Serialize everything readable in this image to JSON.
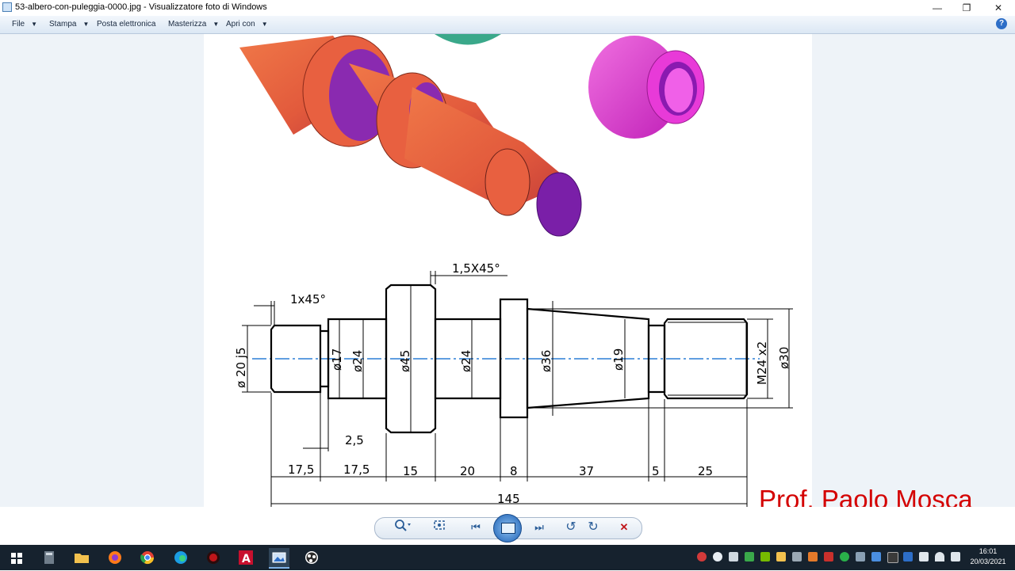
{
  "window": {
    "title": "53-albero-con-puleggia-0000.jpg - Visualizzatore foto di Windows",
    "minimize_glyph": "—",
    "maximize_glyph": "❐",
    "close_glyph": "✕"
  },
  "menu": {
    "items": [
      "File",
      "Stampa",
      "Posta elettronica",
      "Masterizza",
      "Apri con"
    ],
    "help_glyph": "?"
  },
  "drawing": {
    "dims": {
      "chamfer_1": "1x45°",
      "chamfer_2": "1,5X45°",
      "d20": "ø 20  j5",
      "d17": "ø17",
      "d24a": "ø24",
      "d45": "ø45",
      "d24b": "ø24",
      "d36": "ø36",
      "d19": "ø19",
      "m24": "M24 x2",
      "d30": "ø30",
      "groove": "2,5",
      "len_1": "17,5",
      "len_2": "17,5",
      "len_3": "15",
      "len_4": "20",
      "len_5": "8",
      "len_6": "37",
      "len_7": "5",
      "len_8": "25",
      "total": "145"
    }
  },
  "watermark": "Prof. Paolo Mosca",
  "controls": {
    "zoom": "magnifier-icon",
    "fit": "fit-icon",
    "prev": "⏮",
    "next": "⏭",
    "rotate_ccw": "↺",
    "rotate_cw": "↻",
    "delete": "✕"
  },
  "taskbar": {
    "time": "16:01",
    "date": "20/03/2021"
  },
  "colors": {
    "shaft": "#e85a3a",
    "shaft_dark": "#7a1fa8",
    "bushing": "#e23ad0",
    "pulley": "#3aa88a",
    "centerline": "#2b7fd6",
    "watermark": "#d40000"
  }
}
